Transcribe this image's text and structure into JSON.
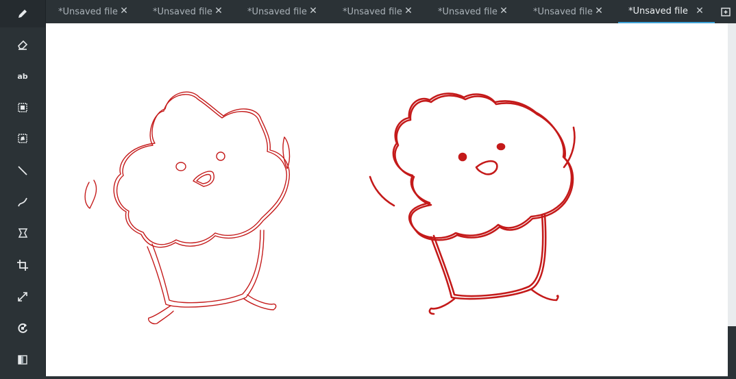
{
  "tabs": [
    {
      "label": "*Unsaved file",
      "active": false
    },
    {
      "label": "*Unsaved file",
      "active": false
    },
    {
      "label": "*Unsaved file",
      "active": false
    },
    {
      "label": "*Unsaved file",
      "active": false
    },
    {
      "label": "*Unsaved file",
      "active": false
    },
    {
      "label": "*Unsaved file",
      "active": false
    },
    {
      "label": "*Unsaved file",
      "active": true
    }
  ],
  "tools": {
    "text_label": "ab"
  },
  "colors": {
    "toolbar_bg": "#2b3236",
    "active_tab_underline": "#3fa4d9",
    "stroke": "#c41a1a"
  },
  "icons": [
    "pencil-icon",
    "eraser-icon",
    "text-icon",
    "rectangle-selection-icon",
    "free-selection-icon",
    "line-icon",
    "curve-icon",
    "skew-icon",
    "crop-icon",
    "scale-icon",
    "rotate-icon",
    "filters-icon",
    "new-tab-icon"
  ]
}
